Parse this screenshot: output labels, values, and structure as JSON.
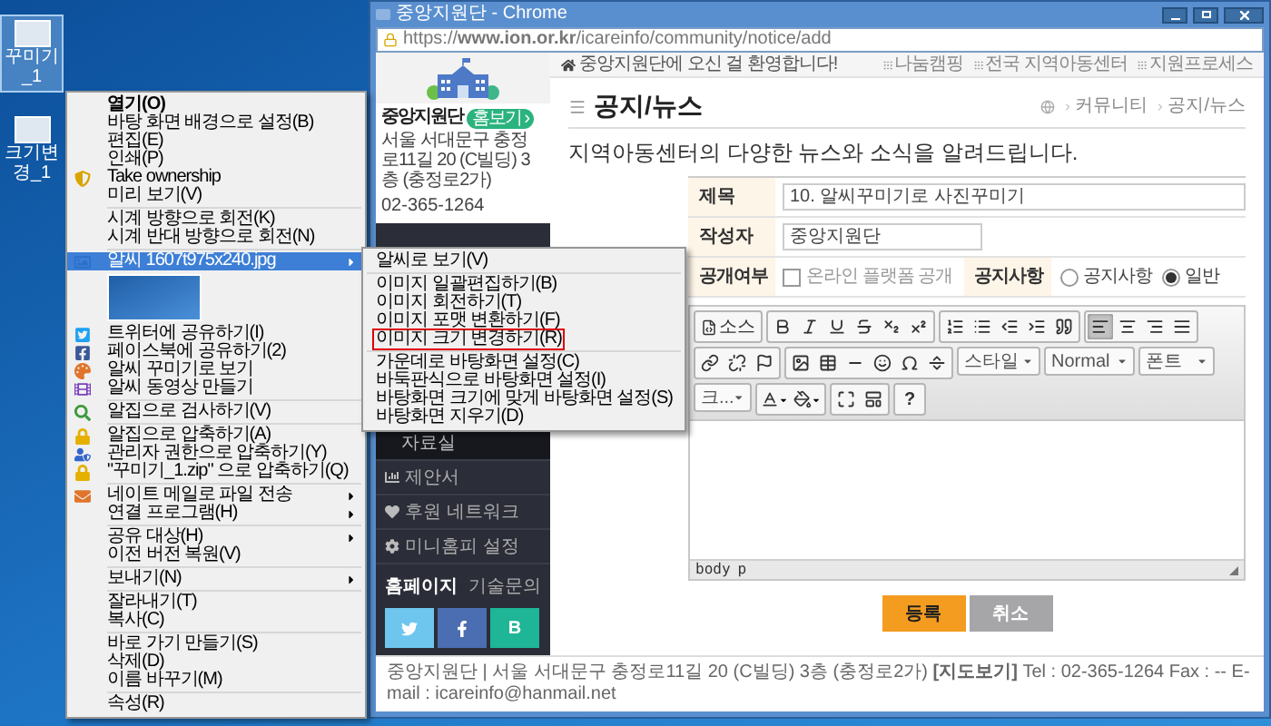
{
  "desktop_icons": [
    {
      "label": "꾸미기_1",
      "selected": true
    },
    {
      "label": "크기변경_1",
      "selected": false
    }
  ],
  "context_menu": {
    "items": [
      {
        "kind": "default",
        "label": "열기(O)",
        "selected": false
      },
      {
        "kind": "item",
        "label": "바탕 화면 배경으로 설정(B)",
        "selected": false
      },
      {
        "kind": "item",
        "label": "편집(E)",
        "selected": false
      },
      {
        "kind": "item",
        "label": "인쇄(P)",
        "selected": false
      },
      {
        "kind": "item",
        "label": "Take ownership",
        "icon": true,
        "selected": false
      },
      {
        "kind": "item",
        "label": "미리 보기(V)",
        "selected": false
      },
      {
        "kind": "separator"
      },
      {
        "kind": "item",
        "label": "시계 방향으로 회전(K)",
        "selected": false
      },
      {
        "kind": "item",
        "label": "시계 반대 방향으로 회전(N)",
        "selected": false
      },
      {
        "kind": "separator"
      },
      {
        "kind": "item",
        "label": "알씨 1607t975x240.jpg",
        "icon": true,
        "arrow": true,
        "selected": true
      },
      {
        "kind": "thumbnail"
      },
      {
        "kind": "item",
        "label": "트위터에 공유하기(I)",
        "icon": true,
        "selected": false
      },
      {
        "kind": "item",
        "label": "페이스북에 공유하기(2)",
        "icon": true,
        "selected": false
      },
      {
        "kind": "item",
        "label": "알씨 꾸미기로 보기",
        "icon": true,
        "selected": false
      },
      {
        "kind": "item",
        "label": "알씨 동영상 만들기",
        "icon": true,
        "selected": false
      },
      {
        "kind": "separator"
      },
      {
        "kind": "item",
        "label": "알집으로 검사하기(V)",
        "icon": true,
        "selected": false
      },
      {
        "kind": "separator"
      },
      {
        "kind": "item",
        "label": "알집으로 압축하기(A)",
        "icon": true,
        "selected": false
      },
      {
        "kind": "item",
        "label": "관리자 권한으로 압축하기(Y)",
        "icon": true,
        "selected": false
      },
      {
        "kind": "item",
        "label": "\"꾸미기_1.zip\" 으로 압축하기(Q)",
        "icon": true,
        "selected": false
      },
      {
        "kind": "separator"
      },
      {
        "kind": "item",
        "label": "네이트 메일로 파일 전송",
        "icon": true,
        "arrow": true,
        "selected": false
      },
      {
        "kind": "item",
        "label": "연결 프로그램(H)",
        "arrow": true,
        "selected": false
      },
      {
        "kind": "separator"
      },
      {
        "kind": "item",
        "label": "공유 대상(H)",
        "arrow": true,
        "selected": false
      },
      {
        "kind": "item",
        "label": "이전 버전 복원(V)",
        "selected": false
      },
      {
        "kind": "separator"
      },
      {
        "kind": "item",
        "label": "보내기(N)",
        "arrow": true,
        "selected": false
      },
      {
        "kind": "separator"
      },
      {
        "kind": "item",
        "label": "잘라내기(T)",
        "selected": false
      },
      {
        "kind": "item",
        "label": "복사(C)",
        "selected": false
      },
      {
        "kind": "separator"
      },
      {
        "kind": "item",
        "label": "바로 가기 만들기(S)",
        "selected": false
      },
      {
        "kind": "item",
        "label": "삭제(D)",
        "selected": false
      },
      {
        "kind": "item",
        "label": "이름 바꾸기(M)",
        "selected": false
      },
      {
        "kind": "separator"
      },
      {
        "kind": "item",
        "label": "속성(R)",
        "selected": false
      }
    ]
  },
  "submenu": {
    "items": [
      {
        "kind": "item",
        "label": "알씨로 보기(V)",
        "marked": false
      },
      {
        "kind": "separator"
      },
      {
        "kind": "item",
        "label": "이미지 일괄편집하기(B)",
        "marked": false
      },
      {
        "kind": "item",
        "label": "이미지 회전하기(T)",
        "marked": false
      },
      {
        "kind": "item",
        "label": "이미지 포맷 변환하기(F)",
        "marked": false
      },
      {
        "kind": "item",
        "label": "이미지 크기 변경하기(R)",
        "marked": true
      },
      {
        "kind": "separator"
      },
      {
        "kind": "item",
        "label": "가운데로 바탕화면 설정(C)",
        "marked": false
      },
      {
        "kind": "item",
        "label": "바둑판식으로 바탕화면 설정(I)",
        "marked": false
      },
      {
        "kind": "item",
        "label": "바탕화면 크기에 맞게 바탕화면 설정(S)",
        "marked": false
      },
      {
        "kind": "item",
        "label": "바탕화면 지우기(D)",
        "marked": false
      }
    ]
  },
  "browser": {
    "title": "중앙지원단 - Chrome",
    "url": "https://**www.ion.or.kr**/icareinfo/community/notice/add",
    "sidebar": {
      "org_name": "중앙지원단",
      "home_badge": "홈보기 ›",
      "address": "서울 서대문구 충정로11길 20 (C빌딩) 3층 (충정로2가)",
      "phone": "02-365-1264",
      "menu": [
        {
          "kind": "sub",
          "label": "자료실"
        },
        {
          "kind": "main",
          "label": "제안서"
        },
        {
          "kind": "main",
          "label": "후원 네트워크"
        },
        {
          "kind": "main",
          "label": "미니홈피 설정"
        }
      ],
      "links": [
        "홈페이지",
        "기술문의"
      ],
      "social": [
        {
          "kind": "twitter"
        },
        {
          "kind": "facebook"
        },
        {
          "kind": "blog",
          "label": "B"
        }
      ]
    },
    "top_bar": {
      "welcome": "중앙지원단에 오신 걸 환영합니다!",
      "links": [
        "나눔캠핑",
        "전국 지역아동센터",
        "지원프로세스"
      ]
    },
    "page": {
      "title": "공지/뉴스",
      "breadcrumb": [
        "커뮤니티",
        "공지/뉴스"
      ],
      "intro": "지역아동센터의 다양한 뉴스와 소식을 알려드립니다.",
      "form": {
        "title_label": "제목",
        "title_value": "10. 알씨꾸미기로 사진꾸미기",
        "author_label": "작성자",
        "author_value": "중앙지원단",
        "public_label": "공개여부",
        "public_checkbox": {
          "label": "온라인 플랫폼 공개",
          "checked": false
        },
        "notice_label": "공지사항",
        "notice_options": [
          {
            "label": "공지사항",
            "selected": false
          },
          {
            "label": "일반",
            "selected": true
          }
        ]
      },
      "editor": {
        "source_label": "소스",
        "align_buttons": [
          {
            "selected": true
          },
          {
            "selected": false
          },
          {
            "selected": false
          },
          {
            "selected": false
          }
        ],
        "dropdowns": [
          "스타일",
          "Normal",
          "폰트",
          "크..."
        ],
        "help_label": "?",
        "path": [
          "body",
          "p"
        ]
      },
      "buttons": [
        {
          "kind": "primary",
          "label": "등록"
        },
        {
          "kind": "secondary",
          "label": "취소"
        }
      ]
    },
    "footer": "중앙지원단 | 서울 서대문구 충정로11길 20 (C빌딩) 3층 (충정로2가) **[지도보기]**   Tel : 02-365-1264  Fax : --  E-mail : icareinfo@hanmail.net"
  }
}
